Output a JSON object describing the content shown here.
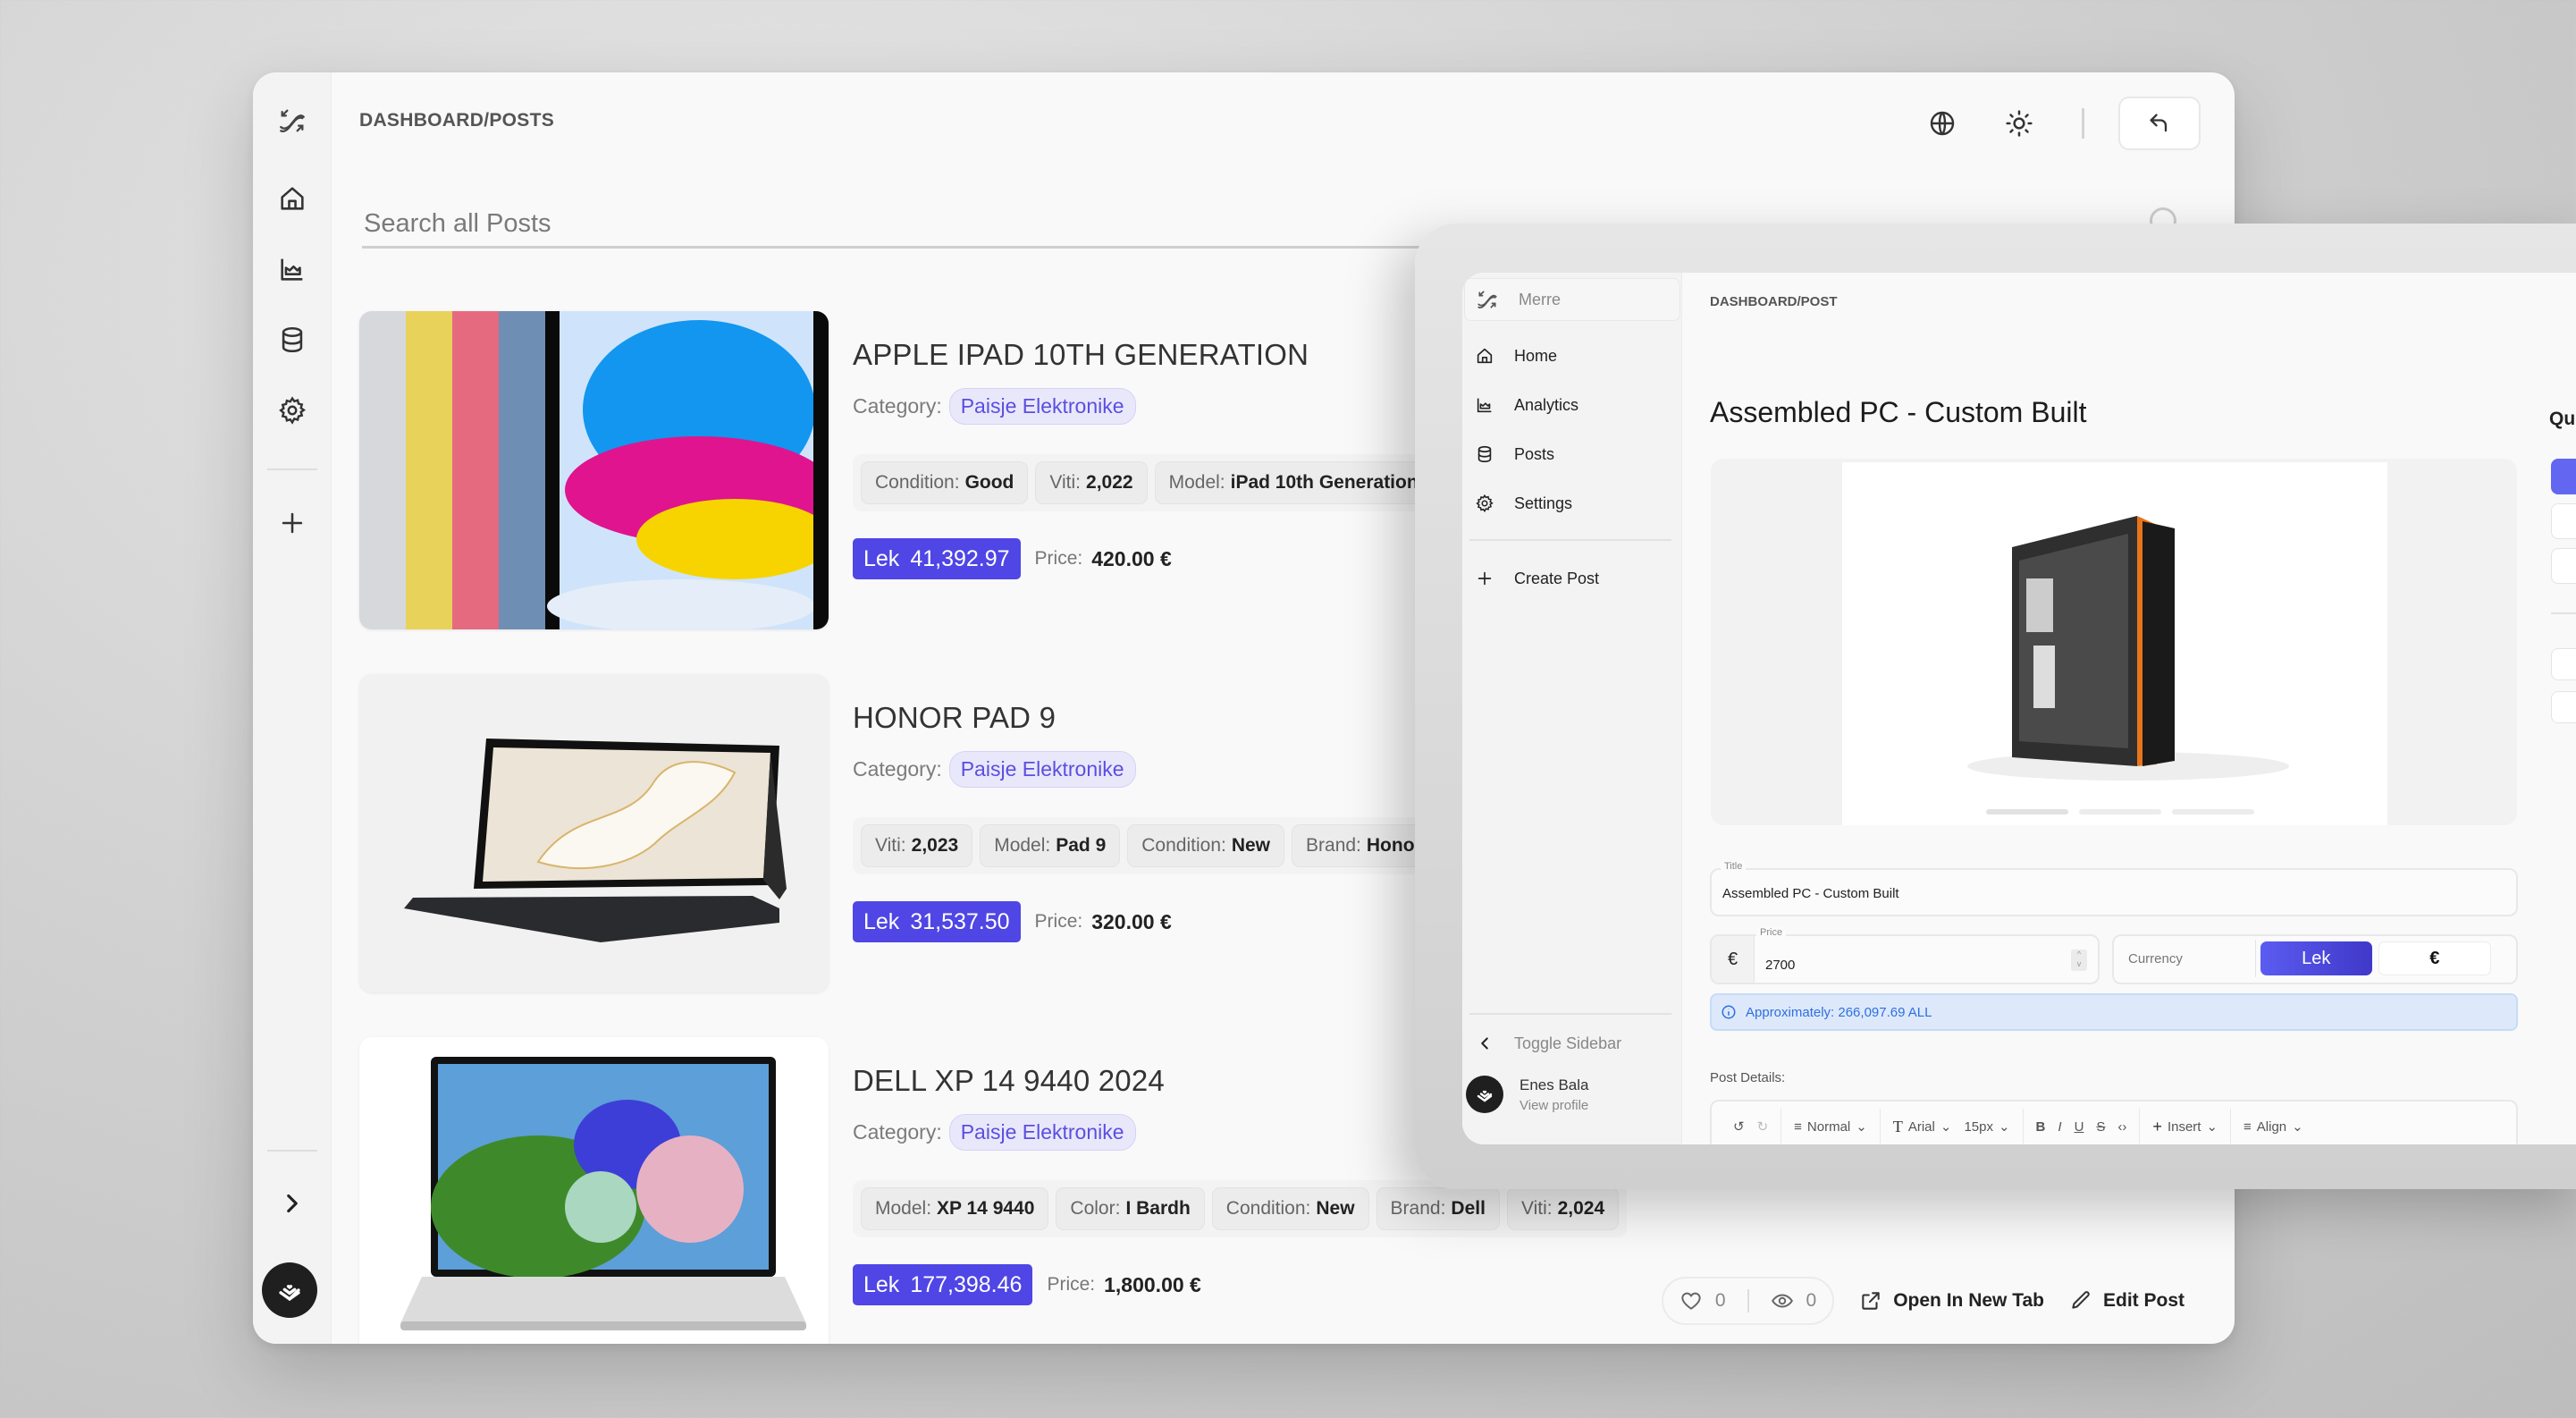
{
  "main": {
    "breadcrumb": "DASHBOARD/POSTS",
    "search": {
      "placeholder": "Search all Posts",
      "value": ""
    },
    "rail": {
      "icons": [
        "logo-icon",
        "home-icon",
        "analytics-icon",
        "database-icon",
        "settings-icon",
        "plus-icon",
        "chevron-right-icon",
        "avatar"
      ]
    },
    "top_actions": {
      "language": "globe-icon",
      "theme": "sun-icon",
      "back": "return-icon"
    },
    "posts": [
      {
        "title": "APPLE IPAD 10TH GENERATION",
        "category_label": "Category:",
        "category": "Paisje Elektronike",
        "specs": [
          {
            "k": "Condition:",
            "v": "Good"
          },
          {
            "k": "Viti:",
            "v": "2,022"
          },
          {
            "k": "Model:",
            "v": "iPad 10th Generation"
          }
        ],
        "lek_currency": "Lek",
        "lek_value": "41,392.97",
        "price_label": "Price:",
        "price_eur": "420.00 €"
      },
      {
        "title": "HONOR PAD 9",
        "category_label": "Category:",
        "category": "Paisje Elektronike",
        "specs": [
          {
            "k": "Viti:",
            "v": "2,023"
          },
          {
            "k": "Model:",
            "v": "Pad 9"
          },
          {
            "k": "Condition:",
            "v": "New"
          },
          {
            "k": "Brand:",
            "v": "Honor"
          }
        ],
        "lek_currency": "Lek",
        "lek_value": "31,537.50",
        "price_label": "Price:",
        "price_eur": "320.00 €"
      },
      {
        "title": "DELL XP 14 9440 2024",
        "category_label": "Category:",
        "category": "Paisje Elektronike",
        "specs": [
          {
            "k": "Model:",
            "v": "XP 14 9440"
          },
          {
            "k": "Color:",
            "v": "I Bardh"
          },
          {
            "k": "Condition:",
            "v": "New"
          },
          {
            "k": "Brand:",
            "v": "Dell"
          },
          {
            "k": "Viti:",
            "v": "2,024"
          }
        ],
        "lek_currency": "Lek",
        "lek_value": "177,398.46",
        "price_label": "Price:",
        "price_eur": "1,800.00 €",
        "likes": "0",
        "views": "0",
        "open_new_tab": "Open In New Tab",
        "edit_post": "Edit Post"
      }
    ]
  },
  "overlay": {
    "sidebar": {
      "brand": "Merre",
      "items": [
        {
          "label": "Home",
          "icon": "home-icon"
        },
        {
          "label": "Analytics",
          "icon": "analytics-icon"
        },
        {
          "label": "Posts",
          "icon": "database-icon"
        },
        {
          "label": "Settings",
          "icon": "settings-icon"
        }
      ],
      "create_post": "Create Post",
      "toggle_sidebar": "Toggle Sidebar",
      "user_name": "Enes Bala",
      "user_link": "View profile"
    },
    "breadcrumb": "DASHBOARD/POST",
    "title": "Assembled PC - Custom Built",
    "quick_label": "Qu",
    "form": {
      "title_label": "Title",
      "title_value": "Assembled PC - Custom Built",
      "price_label": "Price",
      "price_prefix": "€",
      "price_value": "2700",
      "currency_label": "Currency",
      "currency_options": [
        "Lek",
        "€"
      ],
      "currency_selected": "Lek",
      "approx": "Approximately: 266,097.69 ALL",
      "details_label": "Post Details:"
    },
    "toolbar": {
      "block_style": "Normal",
      "font": "Arial",
      "size": "15px",
      "insert": "Insert",
      "align": "Align"
    },
    "gallery": {
      "slides": 3,
      "active_slide": 1
    }
  },
  "colors": {
    "accent": "#4f46e5",
    "chip_bg": "#e9e8fb",
    "chip_text": "#5b4ee0",
    "info_bg": "#dde9fb",
    "info_text": "#2f6fe0"
  }
}
